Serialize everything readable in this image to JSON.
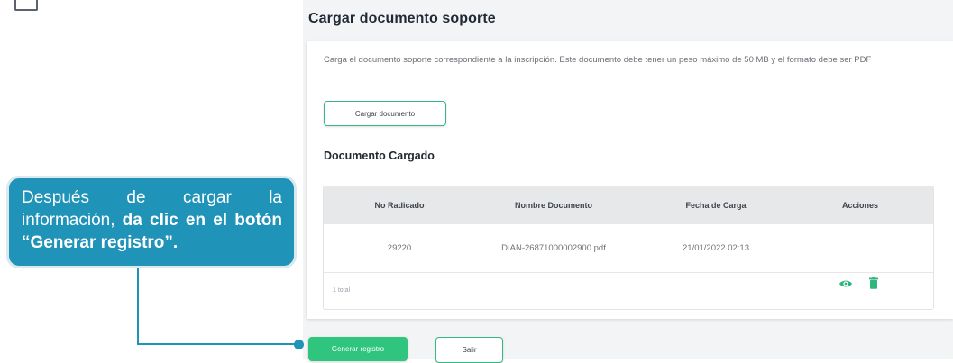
{
  "page": {
    "title": "Cargar documento soporte",
    "description": "Carga el documento soporte correspondiente a la inscripción. Este documento debe tener un peso máximo de 50 MB y el formato debe ser PDF",
    "upload_button": "Cargar documento"
  },
  "uploaded": {
    "section_title": "Documento Cargado",
    "columns": [
      "No Radicado",
      "Nombre Documento",
      "Fecha de Carga",
      "Acciones"
    ],
    "rows": [
      {
        "radicado": "29220",
        "nombre": "DIAN-26871000002900.pdf",
        "fecha": "21/01/2022 02:13",
        "actions": [
          "eye-icon",
          "trash-icon"
        ]
      }
    ],
    "total_label": "1 total"
  },
  "footer": {
    "generate_button": "Generar registro",
    "exit_button": "Salir"
  },
  "callout": {
    "text_normal": "Después de cargar la información, ",
    "text_bold": "da clic en el botón “Generar registro”."
  },
  "colors": {
    "accent_green": "#2fc57e",
    "callout_blue": "#1f93b8",
    "icon_green": "#2fb67d"
  }
}
